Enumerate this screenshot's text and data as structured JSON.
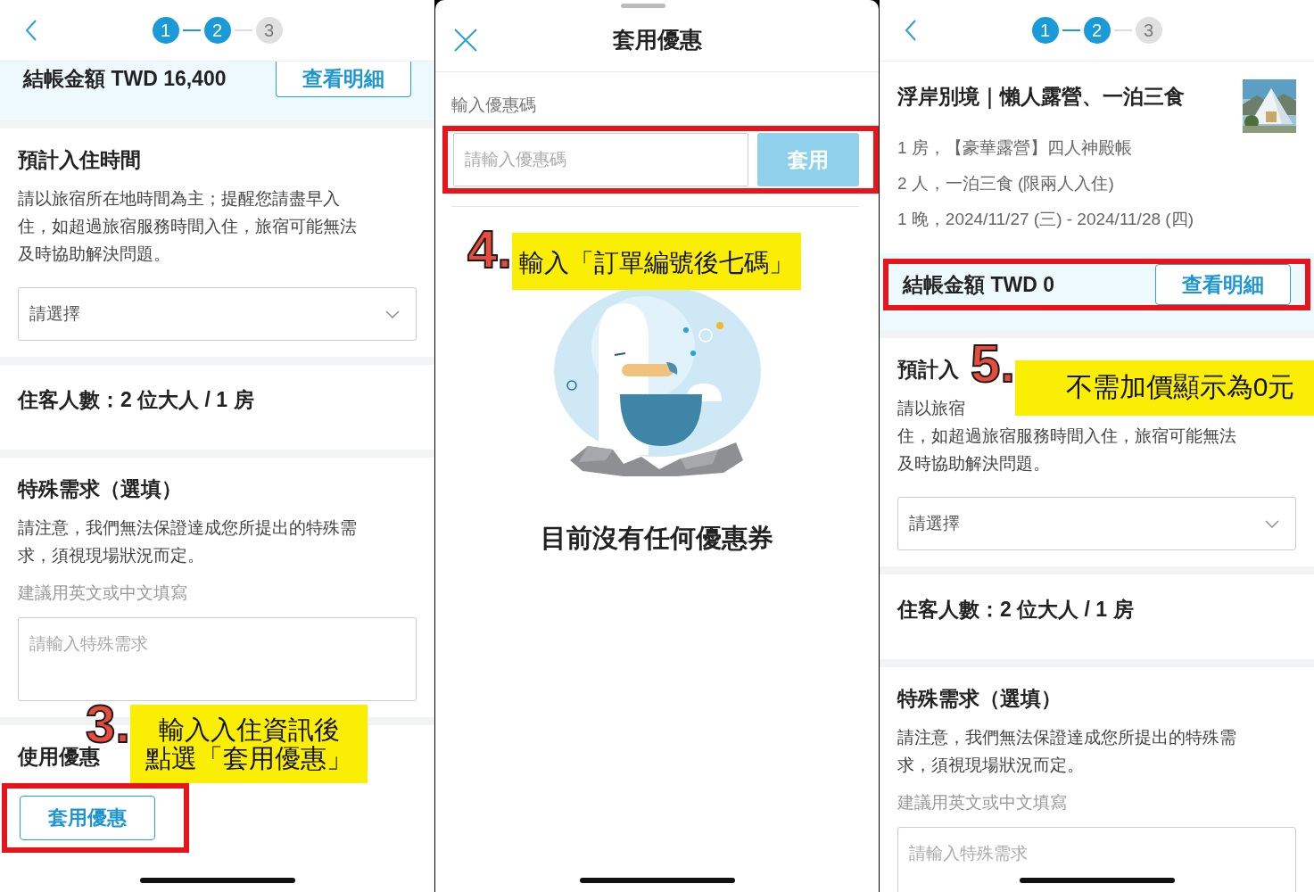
{
  "screens": [
    {
      "kind": "booking",
      "steps": [
        {
          "label": "1",
          "done": true
        },
        {
          "label": "2",
          "done": true
        },
        {
          "label": "3",
          "done": false
        }
      ],
      "total": {
        "label": "結帳金額 TWD 16,400",
        "button": "查看明細",
        "highlighted": false
      },
      "sections": [
        {
          "kind": "checkin",
          "title": "預計入住時間",
          "lines": [
            "請以旅宿所在地時間為主；提醒您請盡早入",
            "住，如超過旅宿服務時間入住，旅宿可能無法",
            "及時協助解決問題。"
          ],
          "select": "請選擇"
        },
        {
          "kind": "guests",
          "title": "住客人數：2 位大人 / 1 房"
        },
        {
          "kind": "special",
          "title": "特殊需求（選填）",
          "lines": [
            "請注意，我們無法保證達成您所提出的特殊需",
            "求，須視現場狀況而定。"
          ],
          "hint": "建議用英文或中文填寫",
          "placeholder": "請輸入特殊需求"
        },
        {
          "kind": "coupon",
          "title": "使用優惠",
          "button": "套用優惠",
          "highlighted": true
        }
      ],
      "annotation": {
        "number": "3.",
        "lines": [
          "輸入入住資訊後",
          "點選「套用優惠」"
        ]
      }
    },
    {
      "kind": "coupon_sheet",
      "title": "套用優惠",
      "field_label": "輸入優惠碼",
      "placeholder": "請輸入優惠碼",
      "apply_button": "套用",
      "apply_disabled": true,
      "highlighted": true,
      "empty_text": "目前沒有任何優惠券",
      "annotation": {
        "number": "4.",
        "lines": [
          "輸入「訂單編號後七碼」"
        ]
      }
    },
    {
      "kind": "booking",
      "steps": [
        {
          "label": "1",
          "done": true
        },
        {
          "label": "2",
          "done": true
        },
        {
          "label": "3",
          "done": false
        }
      ],
      "product": {
        "title": "浮岸別境｜懶人露營、一泊三食",
        "details": [
          "1 房，【豪華露營】四人神殿帳",
          "2 人，一泊三食 (限兩人入住)",
          "1 晚，2024/11/27 (三) - 2024/11/28 (四)"
        ]
      },
      "total": {
        "label": "結帳金額 TWD 0",
        "button": "查看明細",
        "highlighted": true
      },
      "sections": [
        {
          "kind": "checkin",
          "title": "預計入",
          "lines": [
            "請以旅宿",
            "住，如超過旅宿服務時間入住，旅宿可能無法",
            "及時協助解決問題。"
          ],
          "select": "請選擇"
        },
        {
          "kind": "guests",
          "title": "住客人數：2 位大人 / 1 房"
        },
        {
          "kind": "special",
          "title": "特殊需求（選填）",
          "lines": [
            "請注意，我們無法保證達成您所提出的特殊需",
            "求，須視現場狀況而定。"
          ],
          "hint": "建議用英文或中文填寫",
          "placeholder": "請輸入特殊需求"
        }
      ],
      "annotation": {
        "number": "5.",
        "lines": [
          "不需加價顯示為0元"
        ]
      }
    }
  ]
}
